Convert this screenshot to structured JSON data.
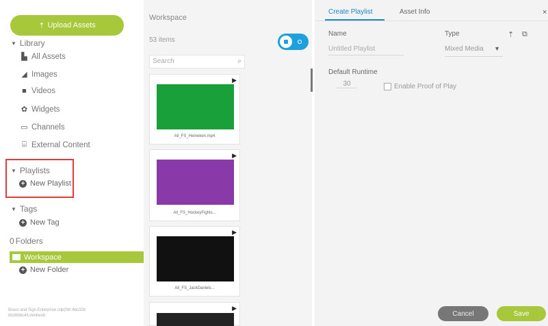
{
  "sidebar": {
    "upload_button": "Upload Assets",
    "library": {
      "header": "Library",
      "items": [
        {
          "label": "All Assets",
          "icon": "file-icon"
        },
        {
          "label": "Images",
          "icon": "image-icon"
        },
        {
          "label": "Videos",
          "icon": "video-icon"
        },
        {
          "label": "Widgets",
          "icon": "widget-icon"
        },
        {
          "label": "Channels",
          "icon": "channel-icon"
        },
        {
          "label": "External Content",
          "icon": "external-content-icon"
        }
      ]
    },
    "playlists": {
      "header": "Playlists",
      "add_label": "New Playlist"
    },
    "tags": {
      "header": "Tags",
      "add_label": "New Tag"
    },
    "folders": {
      "header": "Folders",
      "count": "0",
      "workspace_label": "Workspace",
      "add_label": "New Folder"
    },
    "footer": "Bravo and Sign Enterprise cdp(0th 4bc32b bb16bbc4/Linmbexb"
  },
  "workspace": {
    "title": "Workspace",
    "count": "53 items",
    "search_placeholder": "Search",
    "assets": [
      {
        "caption": "All_FS_Heineken.mp4",
        "color": "#19a03a"
      },
      {
        "caption": "All_FS_HockeyFights...",
        "color": "#8a3aa8"
      },
      {
        "caption": "All_FS_JackDaniels...",
        "color": "#111111"
      },
      {
        "caption": "",
        "color": "#222222"
      }
    ]
  },
  "panel": {
    "tabs": [
      "Create Playlist",
      "Asset Info"
    ],
    "name_label": "Name",
    "name_placeholder": "Untitled Playlist",
    "type_label": "Type",
    "type_value": "Mixed Media",
    "runtime_label": "Default Runtime",
    "runtime_value": "30",
    "proof_of_play_label": "Enable Proof of Play",
    "cancel": "Cancel",
    "save": "Save"
  },
  "colors": {
    "accent_green": "#a6c83a",
    "accent_blue": "#1b87c6",
    "highlight_red": "#e2393a"
  }
}
